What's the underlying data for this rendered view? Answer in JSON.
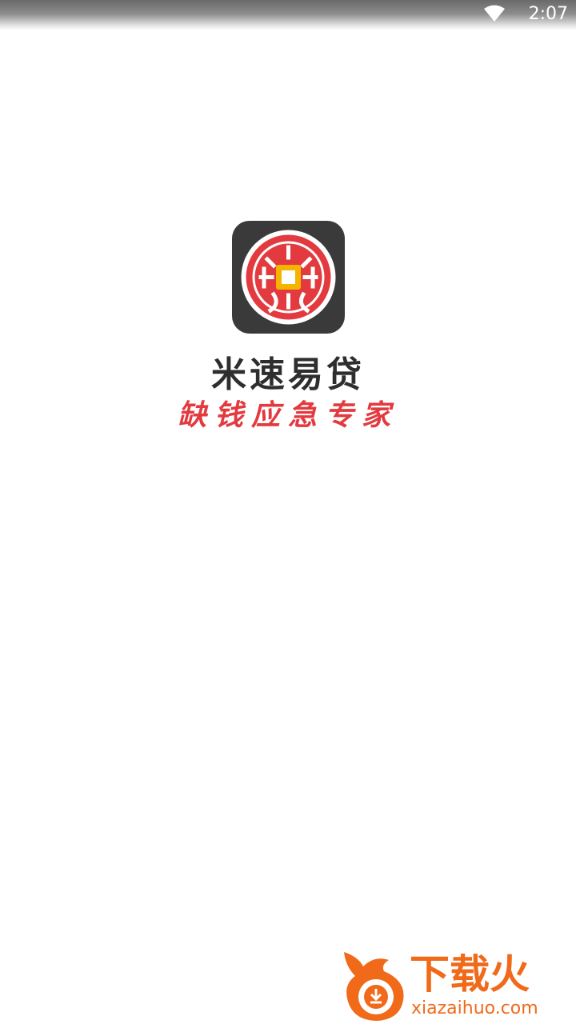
{
  "status_bar": {
    "time": "2:07",
    "icons": [
      "wifi-icon"
    ]
  },
  "splash": {
    "app_name": "米速易贷",
    "slogan": "缺钱应急专家",
    "logo_icon": "coin-logo-icon",
    "colors": {
      "icon_background": "#3a3a3a",
      "logo_red": "#e23a3f",
      "logo_gold": "#f5b400",
      "slogan": "#e23a3f",
      "app_name": "#2e2e2e"
    }
  },
  "watermark": {
    "title": "下载火",
    "url": "xiazaihuo.com",
    "icon": "flame-download-icon",
    "color": "#f06a1a"
  }
}
